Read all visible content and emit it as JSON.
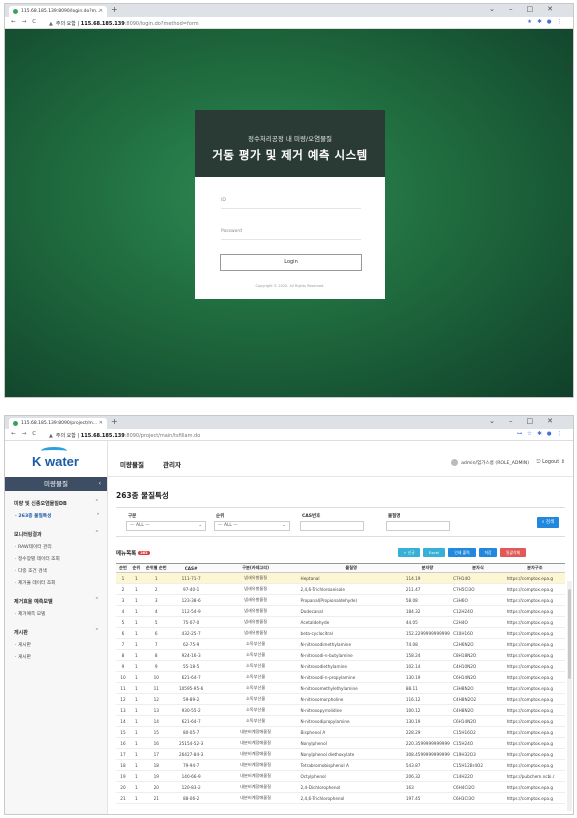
{
  "login_window": {
    "tab_title": "115.68.185.139:8090/login.do?m...",
    "url_warning": "주의 요함",
    "url_host": "115.68.185.139",
    "url_path": ":8090/login.do?method=form",
    "title_small": "정수처리공정 내 미량/오염물질",
    "title_large": "거동 평가 및 제거 예측 시스템",
    "id_label": "ID",
    "password_label": "Password",
    "login_button": "Login",
    "copyright": "Copyright © 2020. All Rights Reserved."
  },
  "app_window": {
    "tab_title": "115.68.185.139:8090/project/m...",
    "url_warning": "주의 요함",
    "url_host": "115.68.185.139",
    "url_path": ":8090/project/main/tsfillam.do",
    "logo_text": "K water",
    "topnav": [
      "미량물질",
      "관리자"
    ],
    "user": "admin/엄가스롱 (ROLE_ADMIN)",
    "logout": "Logout",
    "sidebar_header": "미량물질",
    "sidebar": [
      {
        "title": "미량 및 신종오염물질DB",
        "items": [
          "263종 물질특성"
        ]
      },
      {
        "title": "모니터링결과",
        "items": [
          "RAW데이터 관리",
          "정수장별 데이터 조회",
          "다중 조건 검색",
          "제거율 데이터 조회"
        ]
      },
      {
        "title": "제거효율 예측모델",
        "items": [
          "제거예측 모델"
        ]
      },
      {
        "title": "게시판",
        "items": [
          "게시판",
          "게시판"
        ]
      }
    ],
    "page_title": "263종 물질특성",
    "filters": {
      "category_label": "구분",
      "category_value": "--- ALL ---",
      "order_label": "순위",
      "order_value": "--- ALL ---",
      "cas_label": "CAS번호",
      "name_label": "물질명",
      "search_button": "검색"
    },
    "list_title": "메뉴목록",
    "list_count": "263",
    "actions": [
      "+ 신규",
      "Excel",
      "인쇄 출력",
      "저장",
      "일괄삭제"
    ],
    "colors": {
      "sidebar_header": "#3d4d63",
      "accent": "#2288dd",
      "logo": "#1c5aa6"
    },
    "columns": [
      "순번",
      "순위",
      "순위별 순번",
      "CAS#",
      "구분(카테고리)",
      "물질명",
      "분자량",
      "분자식",
      "분자구조"
    ],
    "rows": [
      [
        "1",
        "1",
        "1",
        "111-71-7",
        "냄새유발물질",
        "Heptanal",
        "114.19",
        "C7H14O",
        "https://comptox.epa.g"
      ],
      [
        "2",
        "1",
        "2",
        "97-40-1",
        "냄새유발물질",
        "2,4,6-Trichloroanisole",
        "211.47",
        "C7H5Cl3O",
        "https://comptox.epa.g"
      ],
      [
        "3",
        "1",
        "3",
        "123-38-6",
        "냄새유발물질",
        "Propanal(Propionaldehyde)",
        "58.08",
        "C3H6O",
        "https://comptox.epa.g"
      ],
      [
        "4",
        "1",
        "4",
        "112-54-9",
        "냄새유발물질",
        "Dodecanal",
        "184.32",
        "C12H24O",
        "https://comptox.epa.g"
      ],
      [
        "5",
        "1",
        "5",
        "75-07-0",
        "냄새유발물질",
        "Acetaldehyde",
        "44.05",
        "C2H4O",
        "https://comptox.epa.g"
      ],
      [
        "6",
        "1",
        "6",
        "432-25-7",
        "냄새유발물질",
        "beta-cyclocitral",
        "152.2299999999999",
        "C10H16O",
        "https://comptox.epa.g"
      ],
      [
        "7",
        "1",
        "7",
        "62-75-9",
        "소독부산물",
        "N-nitrosodimethylamine",
        "74.08",
        "C2H6N2O",
        "https://comptox.epa.g"
      ],
      [
        "8",
        "1",
        "8",
        "924-16-3",
        "소독부산물",
        "N-nitrosodi-n-butylamine",
        "158.24",
        "C8H18N2O",
        "https://comptox.epa.g"
      ],
      [
        "9",
        "1",
        "9",
        "55-18-5",
        "소독부산물",
        "N-nitrosodiethylamine",
        "102.14",
        "C4H10N2O",
        "https://comptox.epa.g"
      ],
      [
        "10",
        "1",
        "10",
        "621-64-7",
        "소독부산물",
        "N-nitrosodi-n-propylamine",
        "130.19",
        "C6H14N2O",
        "https://comptox.epa.g"
      ],
      [
        "11",
        "1",
        "11",
        "10595-95-6",
        "소독부산물",
        "N-nitrosomethylethylamine",
        "88.11",
        "C3H8N2O",
        "https://comptox.epa.g"
      ],
      [
        "12",
        "1",
        "12",
        "59-89-2",
        "소독부산물",
        "N-nitrosomorpholine",
        "116.12",
        "C4H8N2O2",
        "https://comptox.epa.g"
      ],
      [
        "13",
        "1",
        "13",
        "930-55-2",
        "소독부산물",
        "N-nitrosopyrrolidine",
        "100.12",
        "C4H8N2O",
        "https://comptox.epa.g"
      ],
      [
        "14",
        "1",
        "14",
        "621-64-7",
        "소독부산물",
        "N-nitrosodipropylamine",
        "130.19",
        "C6H14N2O",
        "https://comptox.epa.g"
      ],
      [
        "15",
        "1",
        "15",
        "80-05-7",
        "내분비계장애물질",
        "Bisphenol A",
        "228.29",
        "C15H16O2",
        "https://comptox.epa.g"
      ],
      [
        "16",
        "1",
        "16",
        "25154-52-3",
        "내분비계장애물질",
        "Nonylphenol",
        "220.3599999999999",
        "C15H24O",
        "https://comptox.epa.g"
      ],
      [
        "17",
        "1",
        "17",
        "26427-84-3",
        "내분비계장애물질",
        "Nonylphenol diethoxylate",
        "308.4599999999999",
        "C19H32O3",
        "https://comptox.epa.g"
      ],
      [
        "18",
        "1",
        "18",
        "79-94-7",
        "내분비계장애물질",
        "Tetrabromobisphenol A",
        "543.87",
        "C15H12Br4O2",
        "https://comptox.epa.g"
      ],
      [
        "19",
        "1",
        "19",
        "140-66-9",
        "내분비계장애물질",
        "Octylphenol",
        "206.32",
        "C14H22O",
        "https://pubchem.ncbi.r"
      ],
      [
        "20",
        "1",
        "20",
        "120-83-2",
        "내분비계장애물질",
        "2,4-Dichlorophenol",
        "163",
        "C6H4Cl2O",
        "https://comptox.epa.g"
      ],
      [
        "21",
        "1",
        "21",
        "88-06-2",
        "내분비계장애물질",
        "2,4,6-Trichlorophenol",
        "197.45",
        "C6H3Cl3O",
        "https://comptox.epa.g"
      ]
    ]
  }
}
